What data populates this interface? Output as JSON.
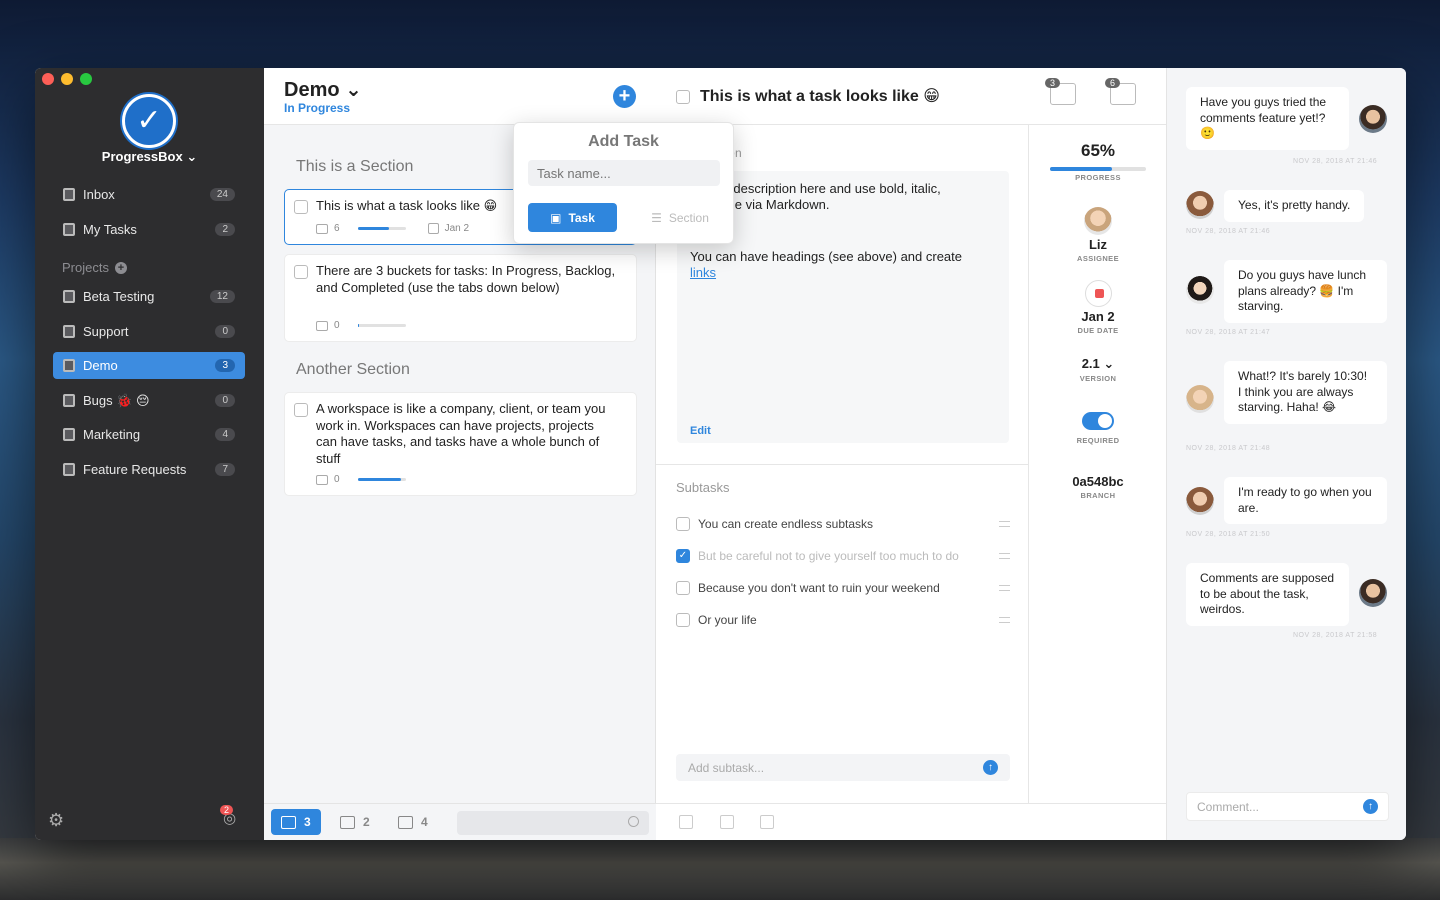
{
  "sidebar": {
    "brand": "ProgressBox ⌄",
    "items": [
      {
        "label": "Inbox",
        "count": "24"
      },
      {
        "label": "My Tasks",
        "count": "2"
      }
    ],
    "projects_header": "Projects",
    "projects": [
      {
        "label": "Beta Testing",
        "count": "12"
      },
      {
        "label": "Support",
        "count": "0"
      },
      {
        "label": "Demo",
        "count": "3"
      },
      {
        "label": "Bugs 🐞 😔",
        "count": "0"
      },
      {
        "label": "Marketing",
        "count": "4"
      },
      {
        "label": "Feature Requests",
        "count": "7"
      }
    ],
    "notification_count": "2",
    "accent": "#3d8ce0"
  },
  "list": {
    "title": "Demo ⌄",
    "status": "In Progress",
    "sections": [
      {
        "title": "This is a Section"
      },
      {
        "title": "Another Section"
      }
    ],
    "tasks": [
      {
        "text": "This is what a task looks like 😁",
        "comments": "6",
        "due": "Jan 2",
        "progress": 0.65
      },
      {
        "text": "There are 3 buckets for tasks: In Progress, Backlog, and Completed (use the tabs down below)",
        "comments": "0",
        "progress": 0.02
      },
      {
        "text": "A workspace is like a company, client, or team you work in. Workspaces can have projects, projects can have tasks, and tasks have a whole bunch of stuff",
        "comments": "0",
        "progress": 0.9
      }
    ],
    "tabs": [
      {
        "count": "3",
        "icon": "inbox-icon"
      },
      {
        "count": "2",
        "icon": "archive-icon"
      },
      {
        "count": "4",
        "icon": "completed-icon"
      }
    ]
  },
  "popover": {
    "title": "Add Task",
    "placeholder": "Task name...",
    "task_label": "Task",
    "section_label": "Section"
  },
  "detail": {
    "title": "This is what a task looks like 😁",
    "attachments": "3",
    "comments": "6",
    "desc_header": "on",
    "desc_line1": "n put a description here and use bold, italic,",
    "desc_line2": "line code via Markdown.",
    "desc_line3": "You can have headings (see above) and create",
    "desc_link": "links",
    "edit_label": "Edit",
    "subtasks_header": "Subtasks",
    "subtasks": [
      {
        "text": "You can create endless subtasks",
        "done": false
      },
      {
        "text": "But be careful not to give yourself too much to do",
        "done": true
      },
      {
        "text": "Because you don't want to ruin your weekend",
        "done": false
      },
      {
        "text": "Or your life",
        "done": false
      }
    ],
    "subtask_placeholder": "Add subtask...",
    "props": {
      "progress_value": "65%",
      "progress_fraction": 0.65,
      "progress_cap": "Progress",
      "assignee": "Liz",
      "assignee_cap": "Assignee",
      "due": "Jan 2",
      "due_cap": "Due Date",
      "version": "2.1 ⌄",
      "version_cap": "Version",
      "required_cap": "Required",
      "required": true,
      "branch": "0a548bc",
      "branch_cap": "Branch"
    }
  },
  "chat": {
    "messages": [
      {
        "text": "Have you guys tried the comments feature yet!? 🙂",
        "time": "NOV 28, 2018 AT 21:46"
      },
      {
        "text": "Yes, it's pretty handy.",
        "time": "NOV 28, 2018 AT 21:46"
      },
      {
        "text": "Do you guys have lunch plans already? 🍔 I'm starving.",
        "time": "NOV 28, 2018 AT 21:47"
      },
      {
        "text": "What!? It's barely 10:30! I think you are always starving. Haha! 😂",
        "time": "NOV 28, 2018 AT 21:48"
      },
      {
        "text": "I'm ready to go when you are.",
        "time": "NOV 28, 2018 AT 21:50"
      },
      {
        "text": "Comments are supposed to be about the task, weirdos.",
        "time": "NOV 28, 2018 AT 21:58"
      }
    ],
    "comment_placeholder": "Comment..."
  }
}
